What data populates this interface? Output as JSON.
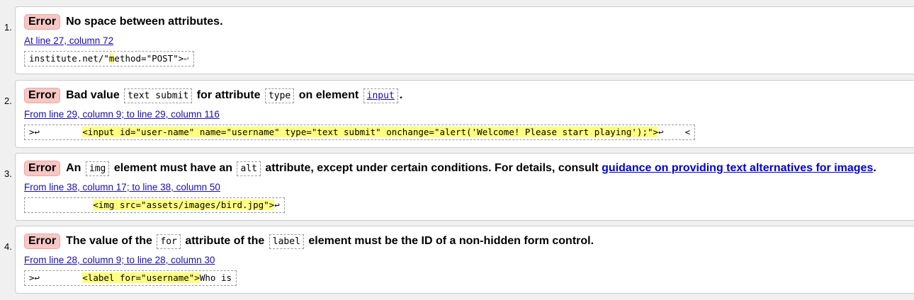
{
  "errors": [
    {
      "num": "1.",
      "type": "Error",
      "message": "No space between attributes.",
      "location": "At line 27, column 72",
      "extract": {
        "before": "institute.net/\"",
        "hl": "m",
        "after": "ethod=\"POST\">",
        "lf": "↩"
      }
    },
    {
      "num": "2.",
      "type": "Error",
      "message_parts": [
        "Bad value",
        "text submit",
        "for attribute",
        "type",
        "on element",
        "input",
        "."
      ],
      "location": "From line 29, column 9; to line 29, column 116",
      "extract": {
        "before": ">↩        ",
        "hl": "<input id=\"user-name\" name=\"username\" type=\"text submit\" onchange=\"alert('Welcome! Please start playing');\">",
        "after": "↩    <"
      }
    },
    {
      "num": "3.",
      "type": "Error",
      "message_parts": [
        "An",
        "img",
        "element must have an",
        "alt",
        "attribute, except under certain conditions. For details, consult",
        "guidance on providing text alternatives for images",
        "."
      ],
      "location": "From line 38, column 17; to line 38, column 50",
      "extract": {
        "before": "            ",
        "hl": "<img src=\"assets/images/bird.jpg\">",
        "after": "↩"
      }
    },
    {
      "num": "4.",
      "type": "Error",
      "message_parts": [
        "The value of the",
        "for",
        "attribute of the",
        "label",
        "element must be the ID of a non-hidden form control."
      ],
      "location": "From line 28, column 9; to line 28, column 30",
      "extract": {
        "before": ">↩        ",
        "hl": "<label for=\"username\">",
        "after": "Who is"
      }
    }
  ]
}
